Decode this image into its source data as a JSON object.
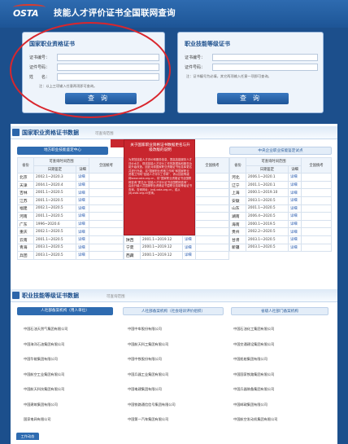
{
  "header": {
    "logo_text": "OSTA",
    "title": "技能人才评价证书全国联网查询"
  },
  "query_left": {
    "title": "国家职业资格证书",
    "fields": [
      {
        "label": "证书编号："
      },
      {
        "label": "证件号码："
      },
      {
        "label": "姓　　名："
      }
    ],
    "hint": "注：以上三项输入任意两项即可查询。",
    "button": "查询"
  },
  "query_right": {
    "title": "职业技能等级证书",
    "fields": [
      {
        "label": "证书编号："
      },
      {
        "label": "证件号码："
      }
    ],
    "hint": "注：证书编号为必填，其它两项输入任意一项即可查询。",
    "button": "查询"
  },
  "section_qual": {
    "title": "国家职业资格证书数据",
    "subtitle": "可查询范围",
    "tab_left": "地方职业技能鉴定中心",
    "tab_right": "中央企业职业技能鉴定试点",
    "headers": {
      "province": "省份",
      "range": "可查询时间范围",
      "date": "日期鉴定",
      "national": "全国统考",
      "link": "详细"
    },
    "left_rows": [
      {
        "p": "北京",
        "d": "2002.1~2020.3",
        "l": "详细"
      },
      {
        "p": "天津",
        "d": "2004.1~2020.4",
        "l": "详细"
      },
      {
        "p": "吉林",
        "d": "2001.1~2020.5",
        "l": "详细"
      },
      {
        "p": "江苏",
        "d": "2001.1~2020.5",
        "l": "详细"
      },
      {
        "p": "福建",
        "d": "2002.1~2020.5",
        "l": "详细"
      },
      {
        "p": "河南",
        "d": "2001.1~2020.5",
        "l": "详细"
      },
      {
        "p": "广东",
        "d": "1996~2020.6",
        "l": "详细"
      },
      {
        "p": "重庆",
        "d": "2002.1~2020.5",
        "l": "详细"
      },
      {
        "p": "云南",
        "d": "2001.1~2020.5",
        "l": "详细"
      },
      {
        "p": "青海",
        "d": "2003.1~2020.5",
        "l": "详细"
      },
      {
        "p": "兵团",
        "d": "2003.1~2020.5",
        "l": "详细"
      }
    ],
    "mid_rows": [
      {
        "p": "河北"
      },
      {
        "p": "内蒙古"
      },
      {
        "p": "黑龙江"
      },
      {
        "p": "浙江"
      },
      {
        "p": "江西"
      },
      {
        "p": "湖北"
      },
      {
        "p": "广西",
        "d": "2000.1~2020.5",
        "l": "详细"
      },
      {
        "p": "四川",
        "d": "1992.1~2019.12",
        "l": "详细"
      },
      {
        "p": "陕西",
        "d": "2001.1~2019.12",
        "l": "详细"
      },
      {
        "p": "宁夏",
        "d": "2000.1~2019.12",
        "l": "详细"
      },
      {
        "p": "西藏",
        "d": "2000.1~2019.12",
        "l": "详细"
      }
    ],
    "right_rows": [
      {
        "p": "河北",
        "d": "2006.1~2020.1",
        "l": "详细"
      },
      {
        "p": "辽宁",
        "d": "2001.1~2020.1",
        "l": "详细"
      },
      {
        "p": "上海",
        "d": "2000.1~2019.10",
        "l": "详细"
      },
      {
        "p": "安徽",
        "d": "2003.1~2020.5",
        "l": "详细"
      },
      {
        "p": "山东",
        "d": "2001.1~2020.5",
        "l": "详细"
      },
      {
        "p": "湖南",
        "d": "2006.4~2020.5",
        "l": "详细"
      },
      {
        "p": "海南",
        "d": "2000.1~2019.5",
        "l": "详细"
      },
      {
        "p": "贵州",
        "d": "2002.2~2020.5",
        "l": "详细"
      },
      {
        "p": "甘肃",
        "d": "2003.1~2020.5",
        "l": "详细"
      },
      {
        "p": "新疆",
        "d": "2003.1~2020.5",
        "l": "详细"
      }
    ]
  },
  "notice": {
    "title": "关于国家职业资格证书数据更名与升级改版的说明",
    "body": "为规范技能人才评价和服务信息，提高技能服务人才评价水平，现将技能人才评价工作的数据库和服务功能升级改造。因此对原国家职业资格证书信息库更名并进行升级，将“国家职业资格工作网”和国家职业资格工作网“技能人才评价工作网”，请以技能等级网www.osta.org.cn，将“国家职业资格证书全国联网查询”更名为“技能人才评价证书全国联网查询”，由此升级人员国家职业资格证书暨职业技能等级证书查询。查询网址：jndj.osta.org.cn，或从jdj.osta.org.cn查询。"
  },
  "section_skill": {
    "title": "职业技能等级证书数据",
    "subtitle": "可查询范围",
    "tabs": [
      "人社部备案机构（用人单位）",
      "人社部备案机构（社会培训评价组织）",
      "省级人社部门备案机构"
    ],
    "orgs": [
      [
        "中国石油天然气集团有限公司",
        "中国中车股份有限公司",
        "中国石油化工集团有限公司"
      ],
      [
        "中国海洋石油集团有限公司",
        "中国航天科工集团有限公司",
        "中国交通建设集团有限公司"
      ],
      [
        "中国华能集团有限公司",
        "中国中铁股份有限公司",
        "中国船舶集团有限公司"
      ],
      [
        "中国航空工业集团有限公司",
        "中国兵器工业集团有限公司",
        "中国国家铁路集团有限公司"
      ],
      [
        "中国航天科技集团有限公司",
        "中国电建集团有限公司",
        "中国兵器装备集团有限公司"
      ],
      [
        "中国建筑集团有限公司",
        "中国铁路通信信号集团有限公司",
        "中国邮政集团有限公司"
      ],
      [
        "国家电网有限公司",
        "中国第一汽车集团有限公司",
        "中国航空发动机集团有限公司"
      ]
    ]
  },
  "footer": {
    "tag": "工作动态"
  },
  "colors": {
    "brand": "#1d5596",
    "accent_red": "#d9262d",
    "notice_red": "#c8262e"
  }
}
